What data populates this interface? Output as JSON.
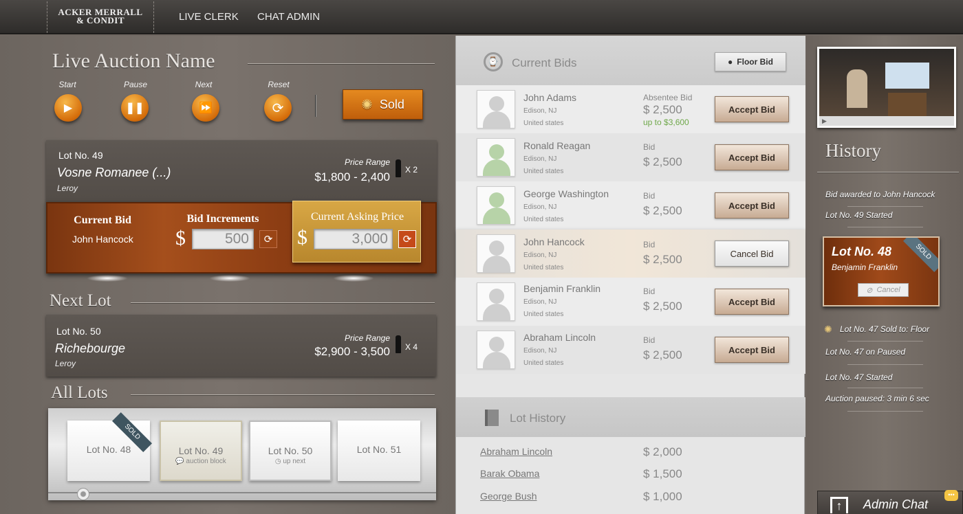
{
  "header": {
    "logo_line1": "ACKER MERRALL",
    "logo_line2": "& CONDIT",
    "nav": [
      "LIVE CLERK",
      "CHAT ADMIN"
    ]
  },
  "auction": {
    "title": "Live Auction Name",
    "controls": {
      "start": "Start",
      "pause": "Pause",
      "next": "Next",
      "reset": "Reset"
    },
    "sold_label": "Sold"
  },
  "current_lot": {
    "lot_no": "Lot No. 49",
    "name": "Vosne Romanee (...)",
    "maker": "Leroy",
    "price_range_label": "Price Range",
    "price_range": "$1,800 - 2,400",
    "qty": "X 2"
  },
  "bidding": {
    "current_bid_label": "Current Bid",
    "current_bidder": "John Hancock",
    "increments_label": "Bid Increments",
    "increment_value": "500",
    "asking_label": "Current Asking Price",
    "asking_value": "3,000",
    "currency": "$"
  },
  "next_lot": {
    "title": "Next Lot",
    "lot_no": "Lot No. 50",
    "name": "Richebourge",
    "maker": "Leroy",
    "price_range_label": "Price Range",
    "price_range": "$2,900 - 3,500",
    "qty": "X 4"
  },
  "all_lots": {
    "title": "All Lots",
    "cards": [
      {
        "label": "Lot No. 48",
        "sub": "",
        "badge": "SOLD"
      },
      {
        "label": "Lot No. 49",
        "sub": "auction block",
        "badge": ""
      },
      {
        "label": "Lot No. 50",
        "sub": "up next",
        "badge": ""
      },
      {
        "label": "Lot No. 51",
        "sub": "",
        "badge": ""
      }
    ]
  },
  "current_bids": {
    "title": "Current Bids",
    "floor_bid_label": "Floor Bid",
    "bids": [
      {
        "name": "John Adams",
        "city": "Edison, NJ",
        "country": "United states",
        "type": "Absentee Bid",
        "amount": "$ 2,500",
        "up_to": "up to $3,600",
        "action": "Accept Bid"
      },
      {
        "name": "Ronald Reagan",
        "city": "Edison, NJ",
        "country": "United states",
        "type": "Bid",
        "amount": "$ 2,500",
        "up_to": "",
        "action": "Accept Bid"
      },
      {
        "name": "George Washington",
        "city": "Edison, NJ",
        "country": "United states",
        "type": "Bid",
        "amount": "$ 2,500",
        "up_to": "",
        "action": "Accept Bid"
      },
      {
        "name": "John Hancock",
        "city": "Edison, NJ",
        "country": "United states",
        "type": "Bid",
        "amount": "$ 2,500",
        "up_to": "",
        "action": "Cancel Bid"
      },
      {
        "name": "Benjamin Franklin",
        "city": "Edison, NJ",
        "country": "United states",
        "type": "Bid",
        "amount": "$ 2,500",
        "up_to": "",
        "action": "Accept Bid"
      },
      {
        "name": "Abraham Lincoln",
        "city": "Edison, NJ",
        "country": "United states",
        "type": "Bid",
        "amount": "$ 2,500",
        "up_to": "",
        "action": "Accept Bid"
      }
    ]
  },
  "lot_history": {
    "title": "Lot History",
    "rows": [
      {
        "name": "Abraham Lincoln",
        "amount": "$ 2,000"
      },
      {
        "name": "Barak Obama",
        "amount": "$ 1,500"
      },
      {
        "name": "George Bush",
        "amount": "$ 1,000"
      }
    ]
  },
  "history": {
    "title": "History",
    "entries_top": [
      "Bid awarded to John Hancock",
      "Lot No. 49 Started"
    ],
    "sold_card": {
      "lot": "Lot No. 48",
      "buyer": "Benjamin Franklin",
      "badge": "SOLD",
      "cancel": "Cancel"
    },
    "entries_bottom": [
      "Lot No. 47  Sold to: Floor",
      "Lot No. 47 on Paused",
      "Lot No. 47 Started",
      "Auction paused: 3 min 6 sec"
    ]
  },
  "admin_chat": {
    "label": "Admin Chat"
  },
  "colors": {
    "accent_orange": "#d56d0a",
    "wood": "#8c3d13",
    "gold": "#c8973a",
    "green": "#6fa84a"
  }
}
